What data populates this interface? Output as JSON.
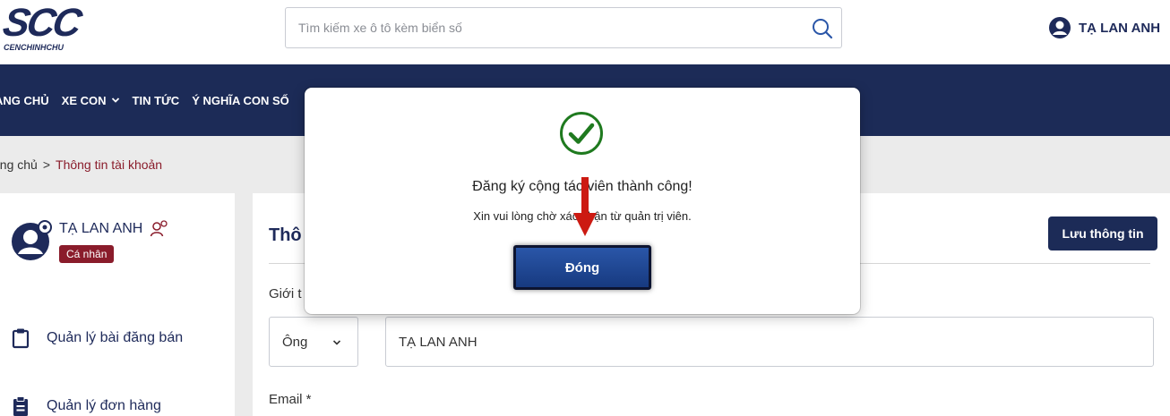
{
  "header": {
    "logo_main": "SCC",
    "logo_sub": "CENCHINHCHU",
    "search_placeholder": "Tìm kiếm xe ô tô kèm biển số",
    "user_name": "TẠ LAN ANH"
  },
  "nav": {
    "items": [
      {
        "label": "ANG CHỦ",
        "icon": null
      },
      {
        "label": "XE CON",
        "icon": "chevron-down-icon"
      },
      {
        "label": "TIN TỨC",
        "icon": null
      },
      {
        "label": "Ý NGHĨA CON SỐ",
        "icon": null
      }
    ]
  },
  "breadcrumb": {
    "home": "ang chủ",
    "separator": ">",
    "current": "Thông tin tài khoản"
  },
  "sidebar": {
    "profile_name": "TẠ LAN ANH",
    "profile_badge": "Cá nhân",
    "items": [
      {
        "label": "Quản lý bài đăng bán",
        "icon": "clipboard-icon"
      },
      {
        "label": "Quản lý đơn hàng",
        "icon": "clipboard-list-icon"
      }
    ]
  },
  "main": {
    "title": "Thô",
    "save_label": "Lưu thông tin",
    "gender_label": "Giới t",
    "gender_value": "Ông",
    "name_value": "TẠ LAN ANH",
    "email_label": "Email *"
  },
  "modal": {
    "title": "Đăng ký cộng tác viên thành công!",
    "message": "Xin vui lòng chờ xác nhận từ quản trị viên.",
    "close_label": "Đóng"
  },
  "colors": {
    "navy": "#1c2b57",
    "accent_red": "#8a1c2b",
    "success_green": "#1f7a1f",
    "arrow_red": "#cc1a12",
    "button_blue": "#2a56a8"
  }
}
